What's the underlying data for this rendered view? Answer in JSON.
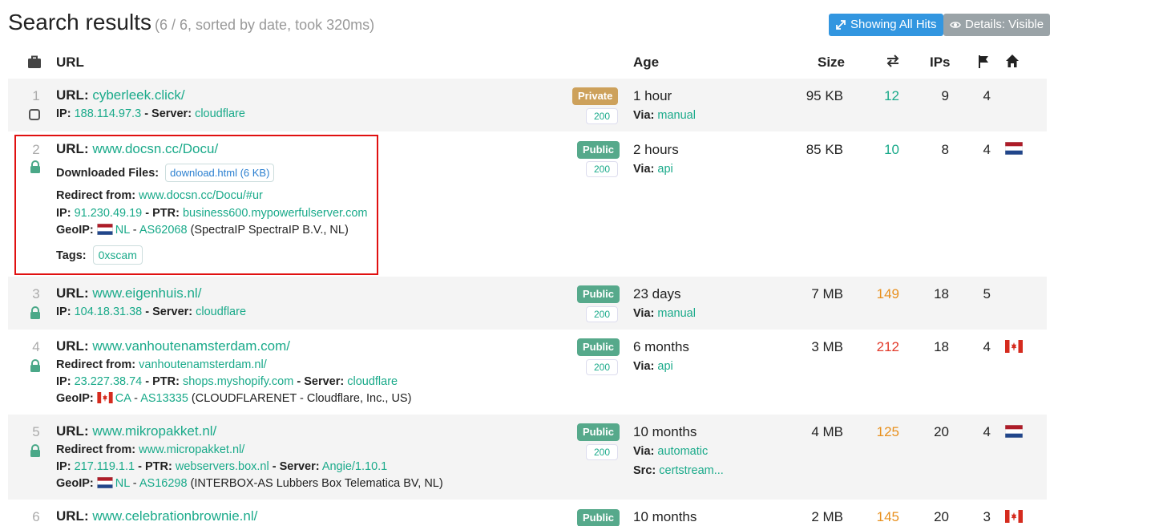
{
  "header": {
    "title": "Search results",
    "subtitle": "(6 / 6, sorted by date, took 320ms)",
    "btn_hits": "Showing All Hits",
    "btn_details": "Details: Visible"
  },
  "table_header": {
    "url": "URL",
    "age": "Age",
    "size": "Size",
    "ips": "IPs"
  },
  "labels": {
    "url": "URL:",
    "ip": "IP:",
    "server": "- Server:",
    "ptr": "- PTR:",
    "redirect": "Redirect from:",
    "geoip": "GeoIP:",
    "downloaded": "Downloaded Files:",
    "tags": "Tags:",
    "via": "Via:",
    "src": "Src:",
    "dash": "-"
  },
  "rows": [
    {
      "num": "1",
      "url": "cyberleek.click/",
      "ip": "188.114.97.3",
      "server": "cloudflare",
      "visibility": "Private",
      "code": "200",
      "age": "1 hour",
      "via": "manual",
      "size": "95 KB",
      "hits": "12",
      "ips": "9",
      "flags": "4"
    },
    {
      "num": "2",
      "url": "www.docsn.cc/Docu/",
      "downloaded": "download.html (6 KB)",
      "redirect": "www.docsn.cc/Docu/#ur",
      "ip": "91.230.49.19",
      "ptr": "business600.mypowerfulserver.com",
      "geo_cc": "NL",
      "geo_as": "AS62068",
      "geo_org": "(SpectraIP SpectraIP B.V., NL)",
      "tag": "0xscam",
      "visibility": "Public",
      "code": "200",
      "age": "2 hours",
      "via": "api",
      "size": "85 KB",
      "hits": "10",
      "ips": "8",
      "flags": "4"
    },
    {
      "num": "3",
      "url": "www.eigenhuis.nl/",
      "ip": "104.18.31.38",
      "server": "cloudflare",
      "visibility": "Public",
      "code": "200",
      "age": "23 days",
      "via": "manual",
      "size": "7 MB",
      "hits": "149",
      "ips": "18",
      "flags": "5"
    },
    {
      "num": "4",
      "url": "www.vanhoutenamsterdam.com/",
      "redirect": "vanhoutenamsterdam.nl/",
      "ip": "23.227.38.74",
      "ptr": "shops.myshopify.com",
      "server": "cloudflare",
      "geo_cc": "CA",
      "geo_as": "AS13335",
      "geo_org": "(CLOUDFLARENET - Cloudflare, Inc., US)",
      "visibility": "Public",
      "code": "200",
      "age": "6 months",
      "via": "api",
      "size": "3 MB",
      "hits": "212",
      "ips": "18",
      "flags": "4"
    },
    {
      "num": "5",
      "url": "www.mikropakket.nl/",
      "redirect": "www.micropakket.nl/",
      "ip": "217.119.1.1",
      "ptr": "webservers.box.nl",
      "server": "Angie/1.10.1",
      "geo_cc": "NL",
      "geo_as": "AS16298",
      "geo_org": "(INTERBOX-AS Lubbers Box Telematica BV, NL)",
      "visibility": "Public",
      "code": "200",
      "age": "10 months",
      "via": "automatic",
      "src": "certstream...",
      "size": "4 MB",
      "hits": "125",
      "ips": "20",
      "flags": "4"
    },
    {
      "num": "6",
      "url": "www.celebrationbrownie.nl/",
      "visibility": "Public",
      "age": "10 months",
      "size": "2 MB",
      "hits": "145",
      "ips": "20",
      "flags": "3"
    }
  ],
  "colors": {
    "accent_teal": "#1aaa8a",
    "private": "#cda15b",
    "public": "#56a98b",
    "hits_orange": "#e8901e",
    "hits_red": "#e23a2a",
    "highlight_box": "#e01010"
  }
}
